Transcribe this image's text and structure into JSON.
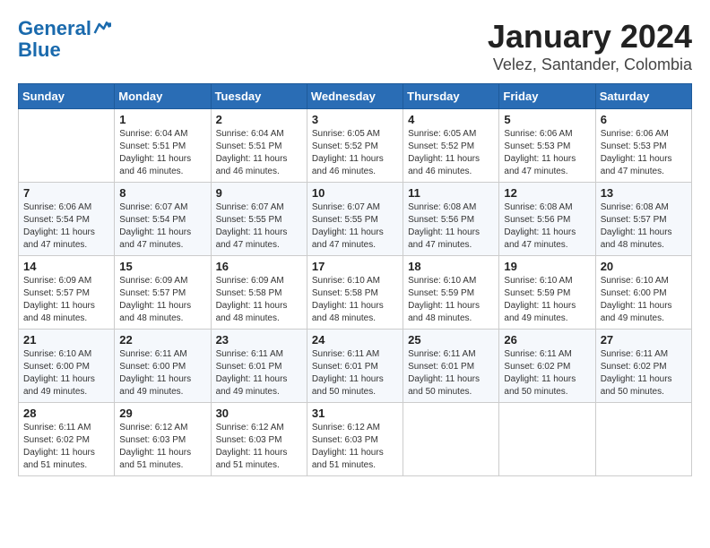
{
  "logo": {
    "line1": "General",
    "line2": "Blue"
  },
  "title": "January 2024",
  "subtitle": "Velez, Santander, Colombia",
  "days_of_week": [
    "Sunday",
    "Monday",
    "Tuesday",
    "Wednesday",
    "Thursday",
    "Friday",
    "Saturday"
  ],
  "weeks": [
    [
      {
        "day": "",
        "sunrise": "",
        "sunset": "",
        "daylight": ""
      },
      {
        "day": "1",
        "sunrise": "Sunrise: 6:04 AM",
        "sunset": "Sunset: 5:51 PM",
        "daylight": "Daylight: 11 hours and 46 minutes."
      },
      {
        "day": "2",
        "sunrise": "Sunrise: 6:04 AM",
        "sunset": "Sunset: 5:51 PM",
        "daylight": "Daylight: 11 hours and 46 minutes."
      },
      {
        "day": "3",
        "sunrise": "Sunrise: 6:05 AM",
        "sunset": "Sunset: 5:52 PM",
        "daylight": "Daylight: 11 hours and 46 minutes."
      },
      {
        "day": "4",
        "sunrise": "Sunrise: 6:05 AM",
        "sunset": "Sunset: 5:52 PM",
        "daylight": "Daylight: 11 hours and 46 minutes."
      },
      {
        "day": "5",
        "sunrise": "Sunrise: 6:06 AM",
        "sunset": "Sunset: 5:53 PM",
        "daylight": "Daylight: 11 hours and 47 minutes."
      },
      {
        "day": "6",
        "sunrise": "Sunrise: 6:06 AM",
        "sunset": "Sunset: 5:53 PM",
        "daylight": "Daylight: 11 hours and 47 minutes."
      }
    ],
    [
      {
        "day": "7",
        "sunrise": "Sunrise: 6:06 AM",
        "sunset": "Sunset: 5:54 PM",
        "daylight": "Daylight: 11 hours and 47 minutes."
      },
      {
        "day": "8",
        "sunrise": "Sunrise: 6:07 AM",
        "sunset": "Sunset: 5:54 PM",
        "daylight": "Daylight: 11 hours and 47 minutes."
      },
      {
        "day": "9",
        "sunrise": "Sunrise: 6:07 AM",
        "sunset": "Sunset: 5:55 PM",
        "daylight": "Daylight: 11 hours and 47 minutes."
      },
      {
        "day": "10",
        "sunrise": "Sunrise: 6:07 AM",
        "sunset": "Sunset: 5:55 PM",
        "daylight": "Daylight: 11 hours and 47 minutes."
      },
      {
        "day": "11",
        "sunrise": "Sunrise: 6:08 AM",
        "sunset": "Sunset: 5:56 PM",
        "daylight": "Daylight: 11 hours and 47 minutes."
      },
      {
        "day": "12",
        "sunrise": "Sunrise: 6:08 AM",
        "sunset": "Sunset: 5:56 PM",
        "daylight": "Daylight: 11 hours and 47 minutes."
      },
      {
        "day": "13",
        "sunrise": "Sunrise: 6:08 AM",
        "sunset": "Sunset: 5:57 PM",
        "daylight": "Daylight: 11 hours and 48 minutes."
      }
    ],
    [
      {
        "day": "14",
        "sunrise": "Sunrise: 6:09 AM",
        "sunset": "Sunset: 5:57 PM",
        "daylight": "Daylight: 11 hours and 48 minutes."
      },
      {
        "day": "15",
        "sunrise": "Sunrise: 6:09 AM",
        "sunset": "Sunset: 5:57 PM",
        "daylight": "Daylight: 11 hours and 48 minutes."
      },
      {
        "day": "16",
        "sunrise": "Sunrise: 6:09 AM",
        "sunset": "Sunset: 5:58 PM",
        "daylight": "Daylight: 11 hours and 48 minutes."
      },
      {
        "day": "17",
        "sunrise": "Sunrise: 6:10 AM",
        "sunset": "Sunset: 5:58 PM",
        "daylight": "Daylight: 11 hours and 48 minutes."
      },
      {
        "day": "18",
        "sunrise": "Sunrise: 6:10 AM",
        "sunset": "Sunset: 5:59 PM",
        "daylight": "Daylight: 11 hours and 48 minutes."
      },
      {
        "day": "19",
        "sunrise": "Sunrise: 6:10 AM",
        "sunset": "Sunset: 5:59 PM",
        "daylight": "Daylight: 11 hours and 49 minutes."
      },
      {
        "day": "20",
        "sunrise": "Sunrise: 6:10 AM",
        "sunset": "Sunset: 6:00 PM",
        "daylight": "Daylight: 11 hours and 49 minutes."
      }
    ],
    [
      {
        "day": "21",
        "sunrise": "Sunrise: 6:10 AM",
        "sunset": "Sunset: 6:00 PM",
        "daylight": "Daylight: 11 hours and 49 minutes."
      },
      {
        "day": "22",
        "sunrise": "Sunrise: 6:11 AM",
        "sunset": "Sunset: 6:00 PM",
        "daylight": "Daylight: 11 hours and 49 minutes."
      },
      {
        "day": "23",
        "sunrise": "Sunrise: 6:11 AM",
        "sunset": "Sunset: 6:01 PM",
        "daylight": "Daylight: 11 hours and 49 minutes."
      },
      {
        "day": "24",
        "sunrise": "Sunrise: 6:11 AM",
        "sunset": "Sunset: 6:01 PM",
        "daylight": "Daylight: 11 hours and 50 minutes."
      },
      {
        "day": "25",
        "sunrise": "Sunrise: 6:11 AM",
        "sunset": "Sunset: 6:01 PM",
        "daylight": "Daylight: 11 hours and 50 minutes."
      },
      {
        "day": "26",
        "sunrise": "Sunrise: 6:11 AM",
        "sunset": "Sunset: 6:02 PM",
        "daylight": "Daylight: 11 hours and 50 minutes."
      },
      {
        "day": "27",
        "sunrise": "Sunrise: 6:11 AM",
        "sunset": "Sunset: 6:02 PM",
        "daylight": "Daylight: 11 hours and 50 minutes."
      }
    ],
    [
      {
        "day": "28",
        "sunrise": "Sunrise: 6:11 AM",
        "sunset": "Sunset: 6:02 PM",
        "daylight": "Daylight: 11 hours and 51 minutes."
      },
      {
        "day": "29",
        "sunrise": "Sunrise: 6:12 AM",
        "sunset": "Sunset: 6:03 PM",
        "daylight": "Daylight: 11 hours and 51 minutes."
      },
      {
        "day": "30",
        "sunrise": "Sunrise: 6:12 AM",
        "sunset": "Sunset: 6:03 PM",
        "daylight": "Daylight: 11 hours and 51 minutes."
      },
      {
        "day": "31",
        "sunrise": "Sunrise: 6:12 AM",
        "sunset": "Sunset: 6:03 PM",
        "daylight": "Daylight: 11 hours and 51 minutes."
      },
      {
        "day": "",
        "sunrise": "",
        "sunset": "",
        "daylight": ""
      },
      {
        "day": "",
        "sunrise": "",
        "sunset": "",
        "daylight": ""
      },
      {
        "day": "",
        "sunrise": "",
        "sunset": "",
        "daylight": ""
      }
    ]
  ]
}
